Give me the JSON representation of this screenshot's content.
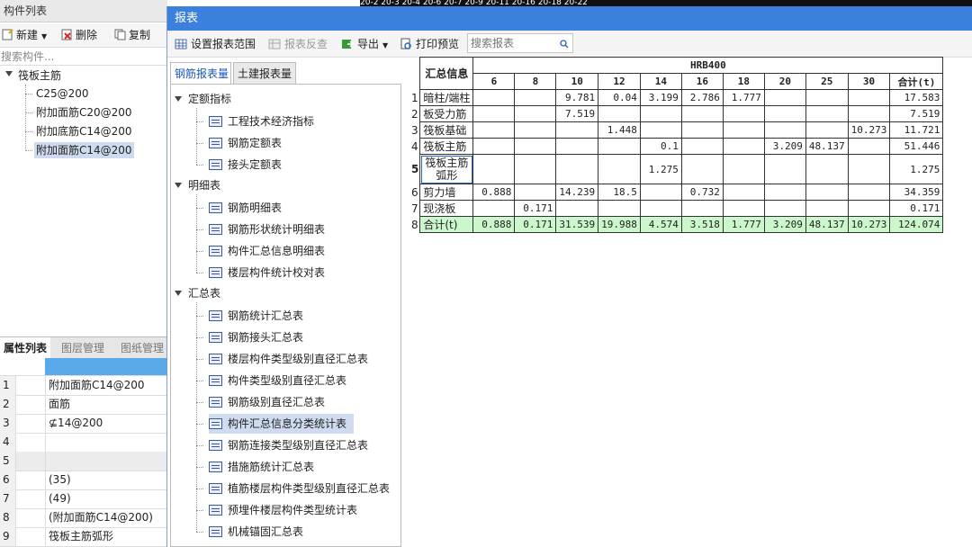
{
  "left_panel": {
    "title": "构件列表",
    "toolbar": {
      "new": "新建",
      "delete": "删除",
      "copy": "复制"
    },
    "search_placeholder": "搜索构件...",
    "tree": {
      "root": "筏板主筋",
      "children": [
        "C25@200",
        "附加面筋C20@200",
        "附加底筋C14@200",
        "附加面筋C14@200"
      ],
      "selected_index": 3
    }
  },
  "props_panel": {
    "tabs": [
      "属性列表",
      "图层管理",
      "图纸管理"
    ],
    "rows": [
      {
        "no": "1",
        "value": "附加面筋C14@200"
      },
      {
        "no": "2",
        "value": "面筋"
      },
      {
        "no": "3",
        "value": "⊈14@200"
      },
      {
        "no": "4",
        "value": ""
      },
      {
        "no": "5",
        "value": ""
      },
      {
        "no": "6",
        "value": "(35)"
      },
      {
        "no": "7",
        "value": "(49)"
      },
      {
        "no": "8",
        "value": "(附加面筋C14@200)"
      },
      {
        "no": "9",
        "value": "筏板主筋弧形"
      }
    ]
  },
  "top_strip": "20-2      20-3   20-4           20-6 20-7 20-9  20-11        20-16       20-18        20-22",
  "window": {
    "title": "报表",
    "toolbar": {
      "set_range": "设置报表范围",
      "reverse_check": "报表反查",
      "export": "导出",
      "print_preview": "打印预览",
      "search_placeholder": "搜索报表"
    },
    "tabs": [
      "钢筋报表量",
      "土建报表量"
    ],
    "tree": [
      {
        "group": "定额指标",
        "items": [
          "工程技术经济指标",
          "钢筋定额表",
          "接头定额表"
        ]
      },
      {
        "group": "明细表",
        "items": [
          "钢筋明细表",
          "钢筋形状统计明细表",
          "构件汇总信息明细表",
          "楼层构件统计校对表"
        ]
      },
      {
        "group": "汇总表",
        "items": [
          "钢筋统计汇总表",
          "钢筋接头汇总表",
          "楼层构件类型级别直径汇总表",
          "构件类型级别直径汇总表",
          "钢筋级别直径汇总表",
          "构件汇总信息分类统计表",
          "钢筋连接类型级别直径汇总表",
          "措施筋统计汇总表",
          "植筋楼层构件类型级别直径汇总表",
          "预埋件楼层构件类型统计表",
          "机械锚固汇总表"
        ]
      }
    ],
    "selected_item": "构件汇总信息分类统计表"
  },
  "report": {
    "corner": "汇总信息",
    "grade": "HRB400",
    "diameters": [
      "6",
      "8",
      "10",
      "12",
      "14",
      "16",
      "18",
      "20",
      "25",
      "30"
    ],
    "total_header": "合计(t)",
    "rows": [
      {
        "no": "1",
        "name": "暗柱/端柱",
        "values": [
          "",
          "",
          "9.781",
          "0.04",
          "3.199",
          "2.786",
          "1.777",
          "",
          "",
          ""
        ],
        "total": "17.583"
      },
      {
        "no": "2",
        "name": "板受力筋",
        "values": [
          "",
          "",
          "7.519",
          "",
          "",
          "",
          "",
          "",
          "",
          ""
        ],
        "total": "7.519"
      },
      {
        "no": "3",
        "name": "筏板基础",
        "values": [
          "",
          "",
          "",
          "1.448",
          "",
          "",
          "",
          "",
          "",
          "10.273"
        ],
        "total": "11.721"
      },
      {
        "no": "4",
        "name": "筏板主筋",
        "values": [
          "",
          "",
          "",
          "",
          "0.1",
          "",
          "",
          "3.209",
          "48.137",
          ""
        ],
        "total": "51.446"
      },
      {
        "no": "5",
        "name": "筏板主筋弧形",
        "values": [
          "",
          "",
          "",
          "",
          "1.275",
          "",
          "",
          "",
          "",
          ""
        ],
        "total": "1.275"
      },
      {
        "no": "6",
        "name": "剪力墙",
        "values": [
          "0.888",
          "",
          "14.239",
          "18.5",
          "",
          "0.732",
          "",
          "",
          "",
          ""
        ],
        "total": "34.359"
      },
      {
        "no": "7",
        "name": "现浇板",
        "values": [
          "",
          "0.171",
          "",
          "",
          "",
          "",
          "",
          "",
          "",
          ""
        ],
        "total": "0.171"
      },
      {
        "no": "8",
        "name": "合计(t)",
        "values": [
          "0.888",
          "0.171",
          "31.539",
          "19.988",
          "4.574",
          "3.518",
          "1.777",
          "3.209",
          "48.137",
          "10.273"
        ],
        "total": "124.074"
      }
    ]
  }
}
